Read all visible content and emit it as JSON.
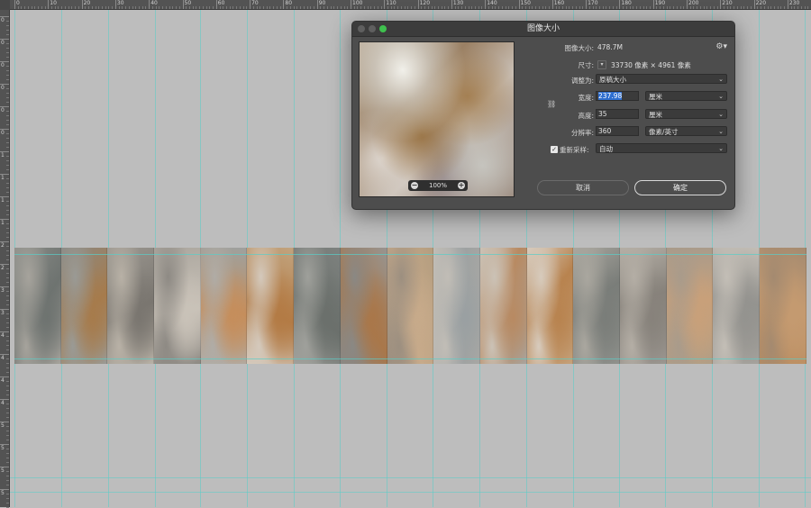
{
  "ruler": {
    "top_labels": [
      "0",
      "10",
      "20",
      "30",
      "40",
      "50",
      "60",
      "70",
      "80",
      "90",
      "100",
      "110",
      "120",
      "130",
      "140",
      "150",
      "160",
      "170",
      "180",
      "190",
      "200",
      "210",
      "220",
      "230"
    ],
    "left_labels": [
      "0",
      "0",
      "0",
      "0",
      "0",
      "0",
      "1",
      "1",
      "1",
      "1",
      "2",
      "2",
      "3",
      "3",
      "4",
      "4",
      "4",
      "4",
      "5",
      "5",
      "5",
      "5"
    ]
  },
  "dialog": {
    "title": "图像大小",
    "image_size_label": "图像大小:",
    "image_size_value": "478.7M",
    "dimensions_label": "尺寸:",
    "dimensions_value": "33730 像素  ×  4961 像素",
    "dimensions_unit_icon": "chevron-down-icon",
    "fit_to_label": "调整为:",
    "fit_to_value": "原稿大小",
    "width_label": "宽度:",
    "width_value": "237.98",
    "width_unit": "厘米",
    "height_label": "高度:",
    "height_value": "35",
    "height_unit": "厘米",
    "resolution_label": "分辨率:",
    "resolution_value": "360",
    "resolution_unit": "像素/英寸",
    "resample_label": "重新采样:",
    "resample_checked": true,
    "resample_value": "自动",
    "zoom_value": "100%",
    "cancel_label": "取消",
    "ok_label": "确定",
    "gear_icon": "gear-icon",
    "link_icon": "link-icon"
  },
  "colors": {
    "canvas_bg": "#bdbdbd",
    "dialog_bg": "#4d4d4d",
    "guide": "#5acdc8",
    "highlight": "#2f6fd0",
    "traffic_green": "#3ec14e"
  }
}
